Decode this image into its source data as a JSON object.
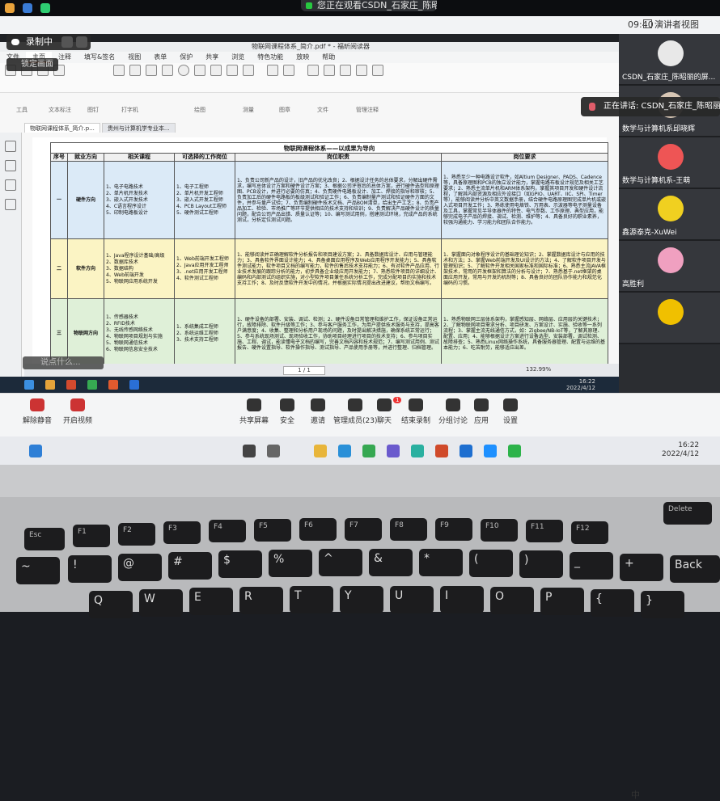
{
  "phone_banner": "您正在观看CSDN_石家庄_陈昭...的屏幕",
  "meeting": {
    "clock": "09:40",
    "speaker_view": "演讲者视图",
    "recording_label": "录制中",
    "lock_screen": "锁定画面",
    "speaking_now": "正在讲话: CSDN_石家庄_陈昭丽;",
    "chat_placeholder": "说点什么...",
    "participants": [
      {
        "name": "CSDN_石家庄_陈昭丽的屏...",
        "color": "#e8e8e8"
      },
      {
        "name": "数学与计算机系邱晓辉",
        "color": "#d8c7b5"
      },
      {
        "name": "数学与计算机系-王萌",
        "color": "#e55"
      },
      {
        "name": "鑫源泰克-XuWei",
        "color": "#f0d020"
      },
      {
        "name": "高胜利",
        "color": "#f0a0c0"
      },
      {
        "name": "",
        "color": "#f0c000"
      }
    ],
    "toolbar": [
      {
        "label": "解除静音",
        "icon": "mic-muted-icon",
        "red": true
      },
      {
        "label": "开启视频",
        "icon": "camera-off-icon",
        "red": true
      },
      {
        "label": "共享屏幕",
        "icon": "share-screen-icon",
        "red": false
      },
      {
        "label": "安全",
        "icon": "shield-icon",
        "red": false
      },
      {
        "label": "邀请",
        "icon": "invite-icon",
        "red": false
      },
      {
        "label": "管理成员(23)",
        "icon": "members-icon",
        "red": false
      },
      {
        "label": "聊天",
        "icon": "chat-icon",
        "red": false,
        "badge": "1"
      },
      {
        "label": "结束录制",
        "icon": "stop-record-icon",
        "red": false
      },
      {
        "label": "分组讨论",
        "icon": "breakout-icon",
        "red": false
      },
      {
        "label": "应用",
        "icon": "apps-icon",
        "red": false
      },
      {
        "label": "设置",
        "icon": "settings-icon",
        "red": false
      }
    ]
  },
  "pdf_app": {
    "title": "物联网课程体系_简介.pdf * - 福昕阅读器",
    "menu": [
      "文件",
      "主页",
      "注释",
      "填写&签名",
      "视图",
      "表单",
      "保护",
      "共享",
      "浏览",
      "特色功能",
      "放映",
      "帮助"
    ],
    "search": "查找",
    "toolbar_groups": [
      "工具",
      "文本标注",
      "图钉",
      "打字机",
      "绘图",
      "测量",
      "图章",
      "文件",
      "管理注释"
    ],
    "doc_tabs": [
      "物联网课程体系_简介.p...",
      "贵州与计算机学专业本..."
    ],
    "page_indicator": "1 / 1",
    "zoom": "132.99%"
  },
  "table": {
    "title": "物联网课程体系——以成果为导向",
    "headers": [
      "序号",
      "就业方向",
      "相关课程",
      "可选择的工作岗位",
      "岗位职责",
      "岗位要求"
    ],
    "rows": [
      {
        "no": "一",
        "direction": "硬件方向",
        "courses": [
          "1、电子电路技术",
          "2、单片机开发技术",
          "3、嵌入式开发技术",
          "4、C语言程序设计",
          "5、印制电路板设计"
        ],
        "jobs": [
          "1、电子工程师",
          "2、单片机开发工程师",
          "3、嵌入式开发工程师",
          "4、PCB Layout工程师",
          "5、硬件测试工程师"
        ],
        "duties": "1、负责公司新产品的设计，旧产品的优化改良；2、根据设计任务的总体要求，分解出硬件需求，编写总体设计方案和硬件设计方案；3、根据公司评审后的总体方案，进行硬件选型和原理图、PCB设计，并进行必要的仿真；4、负责硬件电路板设计、加工、焊接的指导和审核；5、负责加工后的硬件电路板的板级测试和验证工作；6、负责编制量产测试和验证硬件方面的文件，并参与量产试验；7、负责编制硬件技术文档、产品BOM清单，给出生产工艺；8、负责产品加工、检验、市场推广等环节提供相应的技术支持和培训；9、负责解决产品硬件设计的质量问题，配合公司产品出错、质量认证等；10、编写测试用例，搭建测试环境，完成产品的系统测试，分析定位测试问题。",
        "requirements": "1、熟悉至少一种电路设计软件，如Altium Designer、PADS、Cadence等，具备原理图和PCB的独立设计能力，掌握电路布板设计规范及相关工艺要求；2、熟悉主流单片机和ARM体系架构，掌握其项目开发和硬件设计流程，了解其内部资源及相应外设接口（如GPIO、UART、IIC、SPI、Timer等），能够阅读并分析中英文数据手册，结合硬件电路原理图完成单片机或嵌入式项目开发工作；3、熟练使用电烙铁、万用表、示波器等电子测量设备及工具，掌握常见半导体器件的特性、电气参数、工作原理、典型应用，能够完成电子产品的焊接、调试、检测、维护等；4、具备良好的职业素养，较强沟通能力、学习能力和团队合作能力。"
      },
      {
        "no": "二",
        "direction": "软件方向",
        "courses": [
          "1、Java程序设计基础/高级",
          "2、数据库技术",
          "3、数据结构",
          "4、Web前端开发",
          "5、物联网应用系统开发"
        ],
        "jobs": [
          "1、Web前端开发工程师",
          "2、Java应用开发工程师",
          "3、.net应用开发工程师",
          "4、软件测试工程师"
        ],
        "duties": "1、能够阅读并正确理解软件分析报告和项目建设方案；2、具备数据库设计、应用与管理能力；3、具备软件界面设计能力；4、具备桌面应用程序及Web应用程序开发能力；5、具备软件测试能力，软件项目文档的编写能力，软件的售后技术支持能力；6、有对软件产品应用、行业技术发展的跟踪分析的能力，初步具备企业级应用开发能力；7、熟悉软件项目的详细设计、编码和内部测试的组织实施，对小型软件项目兼任系统分析工作，完成分配项目的实施和技术支持工作；8、及时反馈软件开发中的情况，并根据实际情况提出改进建议，帮助文档编写。",
        "requirements": "1、掌握面向对象程序设计的基础理论知识；2、掌握数据库设计与应用的技术和方法；3、掌握Web前端开发及UI设计的方法；4、了解软件项目开发与管理知识；5、了解软件开发相关国家标准和国际标准；6、熟悉主流JAVA框架技术，常用的开发框架和算法的分析与设计；7、熟悉基于.net框架的桌面应用开发，常用与开发的机制等；8、具备良好的团队协作能力和规范化编码的习惯。"
      },
      {
        "no": "三",
        "direction": "物联网方向",
        "courses": [
          "1、传感器技术",
          "2、RFID技术",
          "3、无线传感网络技术",
          "4、物联网项目规划与实施",
          "5、物联网通信技术",
          "6、物联网信息安全技术"
        ],
        "jobs": [
          "1、系统集成工程师",
          "2、系统运维工程师",
          "3、技术支持工程师"
        ],
        "duties": "1、硬件设备的部署、安装、调试、检测；2、硬件设备日常管理和维护工作，保证设备正常运行，故障排除、软件升级等工作；3、参与客户服务工作，为用户提供技术服务与支持，提高客户满意度；4、收集、整理和分析用户现场的问题，及时提出解决措施，确保系统正常运行；5、参与系统现场测试、现场验收工作，协助项目经理进行项目的技术支持；6、参与项目实施、工程、调试，能读懂电子文档的编写，完善文档内容和技术规范；7、编写测试用例、测试报告、硬件设置指导、软件操作指导、测试指导、产品使用手册等，并进行整理、归档管理。",
        "requirements": "1、熟悉物联网三层体系架构，掌握感知层、网络层、应用层的关键技术；2、了解物联网项目需求分析、项目研发、方案设计、实施、验收等一系列流程；3、掌握主流无线通信方式，如：Zigbee/NB-IoT等，了解其原理、配置、应用；4、能够根据设计方案进行设备选型、安装部署、调试检测、故障排查；5、熟悉Linux网络操作系统，具备服务器管理、配置与运维的基本能力；6、吃苦耐劳，能够适应出差。"
      }
    ]
  },
  "inner_clock": {
    "time": "16:22",
    "date": "2022/4/12"
  },
  "windows": {
    "time": "16:22",
    "date": "2022/4/12",
    "ime": "中"
  }
}
